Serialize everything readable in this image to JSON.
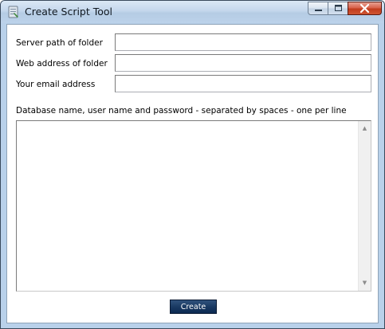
{
  "window": {
    "title": "Create Script Tool",
    "app_icon": "script-tool-icon",
    "controls": {
      "minimize": "minimize-icon",
      "maximize": "maximize-icon",
      "close": "close-icon"
    }
  },
  "form": {
    "server_path_label": "Server path of folder",
    "server_path_value": "",
    "web_address_label": "Web address of folder",
    "web_address_value": "",
    "email_label": "Your email address",
    "email_value": "",
    "databases_label": "Database name, user name and password - separated by spaces - one per line",
    "databases_value": ""
  },
  "actions": {
    "create_label": "Create"
  },
  "colors": {
    "button_bg": "#1a3a63",
    "button_text": "#ffffff",
    "window_frame": "#b9d1ea"
  }
}
